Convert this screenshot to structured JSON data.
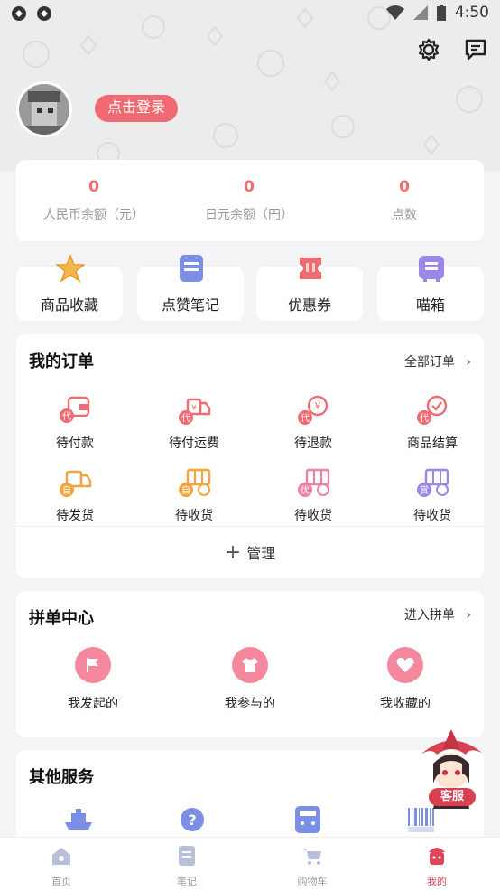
{
  "status": {
    "time": "4:50"
  },
  "header": {
    "login_label": "点击登录"
  },
  "balance": [
    {
      "value": "0",
      "label": "人民币余额（元）"
    },
    {
      "value": "0",
      "label": "日元余额（円）"
    },
    {
      "value": "0",
      "label": "点数"
    }
  ],
  "shortcuts": [
    {
      "label": "商品收藏",
      "icon": "star-icon"
    },
    {
      "label": "点赞笔记",
      "icon": "note-icon"
    },
    {
      "label": "优惠券",
      "icon": "coupon-icon"
    },
    {
      "label": "喵箱",
      "icon": "box-icon"
    }
  ],
  "orders": {
    "title": "我的订单",
    "link": "全部订单",
    "items": [
      {
        "label": "待付款",
        "badge": "代"
      },
      {
        "label": "待付运费",
        "badge": "代"
      },
      {
        "label": "待退款",
        "badge": "代"
      },
      {
        "label": "商品结算",
        "badge": "代"
      },
      {
        "label": "待发货",
        "badge": "自"
      },
      {
        "label": "待收货",
        "badge": "自"
      },
      {
        "label": "待收货",
        "badge": "优"
      },
      {
        "label": "待收货",
        "badge": "赏"
      }
    ],
    "manage": "管理"
  },
  "group": {
    "title": "拼单中心",
    "link": "进入拼单",
    "items": [
      {
        "label": "我发起的"
      },
      {
        "label": "我参与的"
      },
      {
        "label": "我收藏的"
      }
    ]
  },
  "other": {
    "title": "其他服务"
  },
  "service": {
    "label": "客服"
  },
  "tabs": [
    {
      "label": "首页"
    },
    {
      "label": "笔记"
    },
    {
      "label": "购物车"
    },
    {
      "label": "我的"
    }
  ],
  "colors": {
    "accent": "#f06a72",
    "active_tab": "#e0455a"
  }
}
